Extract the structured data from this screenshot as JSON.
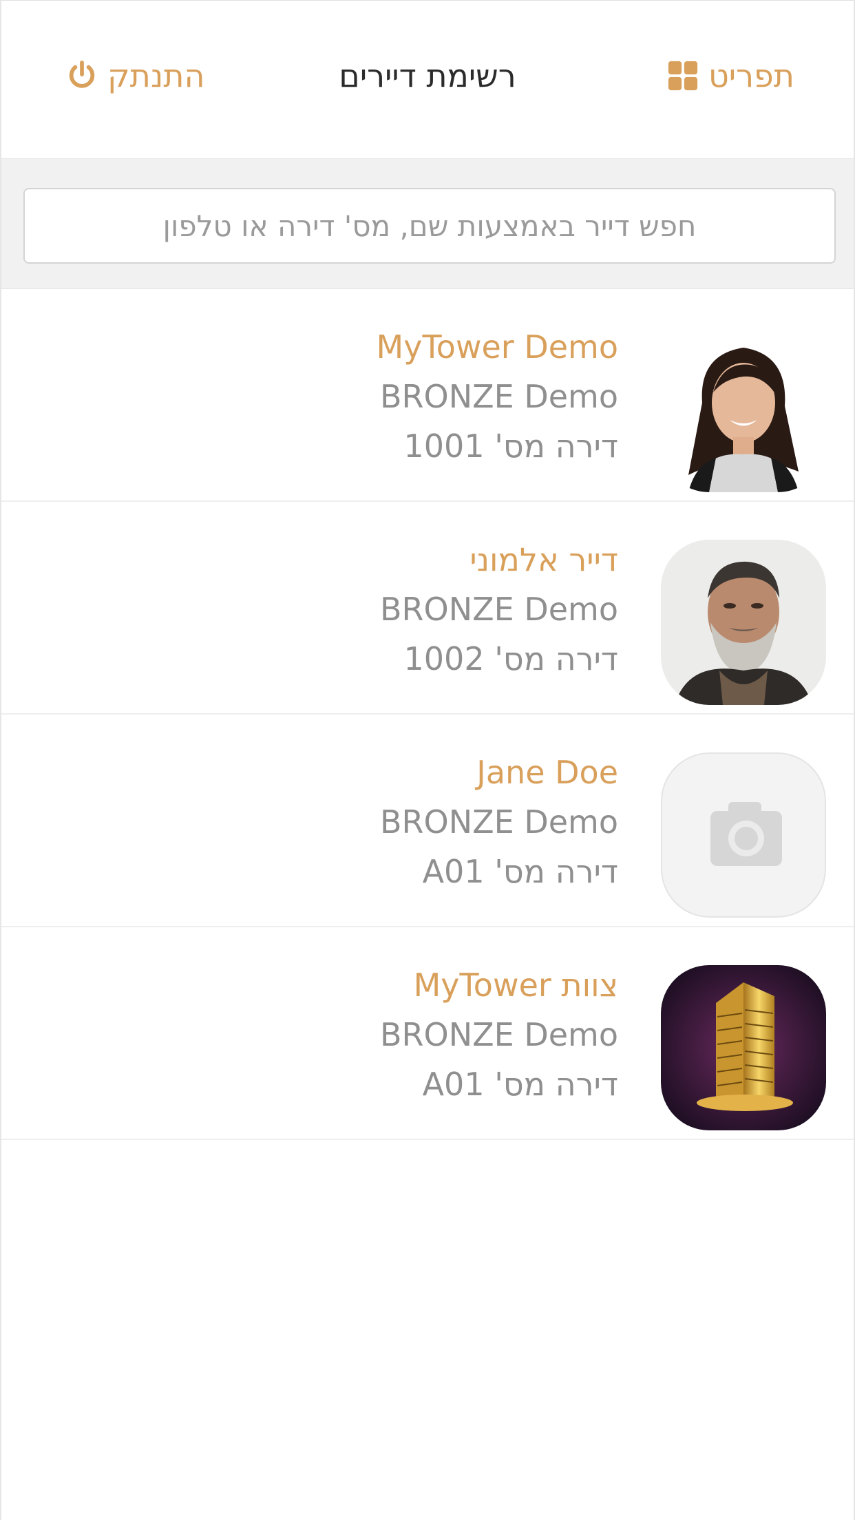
{
  "header": {
    "title": "רשימת דיירים",
    "logout_label": "התנתק",
    "menu_label": "תפריט",
    "accent_color": "#d9a05b"
  },
  "search": {
    "placeholder": "חפש דייר באמצעות שם, מס' דירה או טלפון",
    "value": ""
  },
  "residents": [
    {
      "name": "MyTower Demo",
      "plan": "BRONZE Demo",
      "apartment": "דירה מס' 1001",
      "avatar": "woman-photo"
    },
    {
      "name": "דייר אלמוני",
      "plan": "BRONZE Demo",
      "apartment": "דירה מס' 1002",
      "avatar": "man-photo"
    },
    {
      "name": "Jane Doe",
      "plan": "BRONZE Demo",
      "apartment": "דירה מס' A01",
      "avatar": "camera-placeholder-icon"
    },
    {
      "name": "צוות MyTower",
      "plan": "BRONZE Demo",
      "apartment": "דירה מס' A01",
      "avatar": "tower-logo"
    }
  ]
}
